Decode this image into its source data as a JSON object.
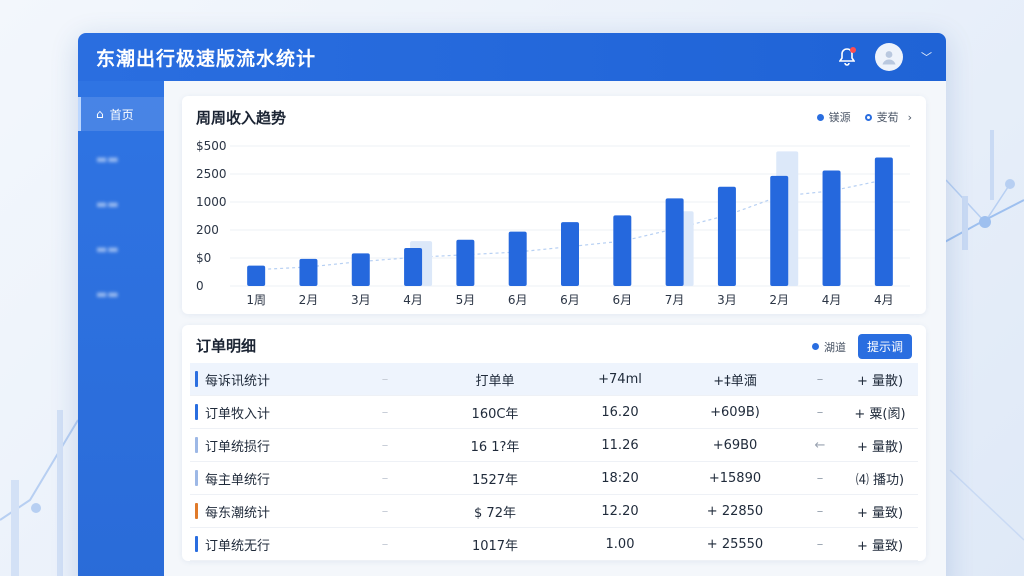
{
  "app": {
    "title": "东潮出行极速版流水统计"
  },
  "header": {
    "bell_icon": "bell-icon",
    "avatar_icon": "user-avatar-icon"
  },
  "sidebar": {
    "items": [
      {
        "label": "首页",
        "icon": "home-icon",
        "active": true
      }
    ]
  },
  "chart": {
    "title": "周周收入趋势",
    "legend": [
      {
        "label": "镁源",
        "marker": "dot"
      },
      {
        "label": "芰荀",
        "marker": "ring"
      }
    ],
    "more_icon": "chevron-right-icon"
  },
  "chart_data": {
    "type": "bar",
    "y_tick_labels": [
      "0",
      "$0",
      "200",
      "1000",
      "2500",
      "$500"
    ],
    "categories": [
      "1周",
      "2月",
      "3月",
      "4月",
      "5月",
      "6月",
      "6月",
      "6月",
      "7月",
      "3月",
      "2月",
      "4月",
      "4月"
    ],
    "values": [
      150,
      200,
      240,
      280,
      340,
      400,
      470,
      520,
      645,
      730,
      810,
      850,
      945
    ],
    "ghost_values": [
      null,
      null,
      null,
      330,
      null,
      null,
      null,
      null,
      550,
      null,
      990,
      null,
      null
    ],
    "trend": [
      120,
      140,
      180,
      210,
      230,
      250,
      290,
      330,
      420,
      520,
      660,
      700,
      780
    ],
    "ylim": [
      0,
      1030
    ]
  },
  "table": {
    "title": "订单明细",
    "legend_label": "湖道",
    "button_label": "提示调",
    "rows": [
      {
        "name": "每诉讯统计",
        "dash1": "–",
        "c2": "打单单",
        "c3": "+74ml",
        "c4": "+‡单湎",
        "dash2": "–",
        "c6": "+ 量散)",
        "bar_color": "#2a6ee0",
        "highlight": true
      },
      {
        "name": "订单牧入计",
        "dash1": "–",
        "c2": "160C年",
        "c3": "16.20",
        "c4": "+609B)",
        "dash2": "–",
        "c6": "+ 粟(阂)",
        "bar_color": "#2a6ee0",
        "highlight": false
      },
      {
        "name": "订单统损行",
        "dash1": "–",
        "c2": "16 1?年",
        "c3": "11.26",
        "c4": "+69B0",
        "dash2": "←",
        "c6": "+ 量散)",
        "bar_color": "#9db8e6",
        "highlight": false
      },
      {
        "name": "每主单统行",
        "dash1": "–",
        "c2": "1527年",
        "c3": "18:20",
        "c4": "+15890",
        "dash2": "–",
        "c6": "⑷ 播功)",
        "bar_color": "#9db8e6",
        "highlight": false
      },
      {
        "name": "每东潮统计",
        "dash1": "–",
        "c2": "$ 72年",
        "c3": "12.20",
        "c4": "+ 22850",
        "dash2": "–",
        "c6": "+ 量致)",
        "bar_color": "#e07a2a",
        "highlight": false
      },
      {
        "name": "订单统无行",
        "dash1": "–",
        "c2": "1017年",
        "c3": "1.00",
        "c4": "+ 25550",
        "dash2": "–",
        "c6": "+ 量致)",
        "bar_color": "#2a6ee0",
        "highlight": false
      }
    ]
  }
}
